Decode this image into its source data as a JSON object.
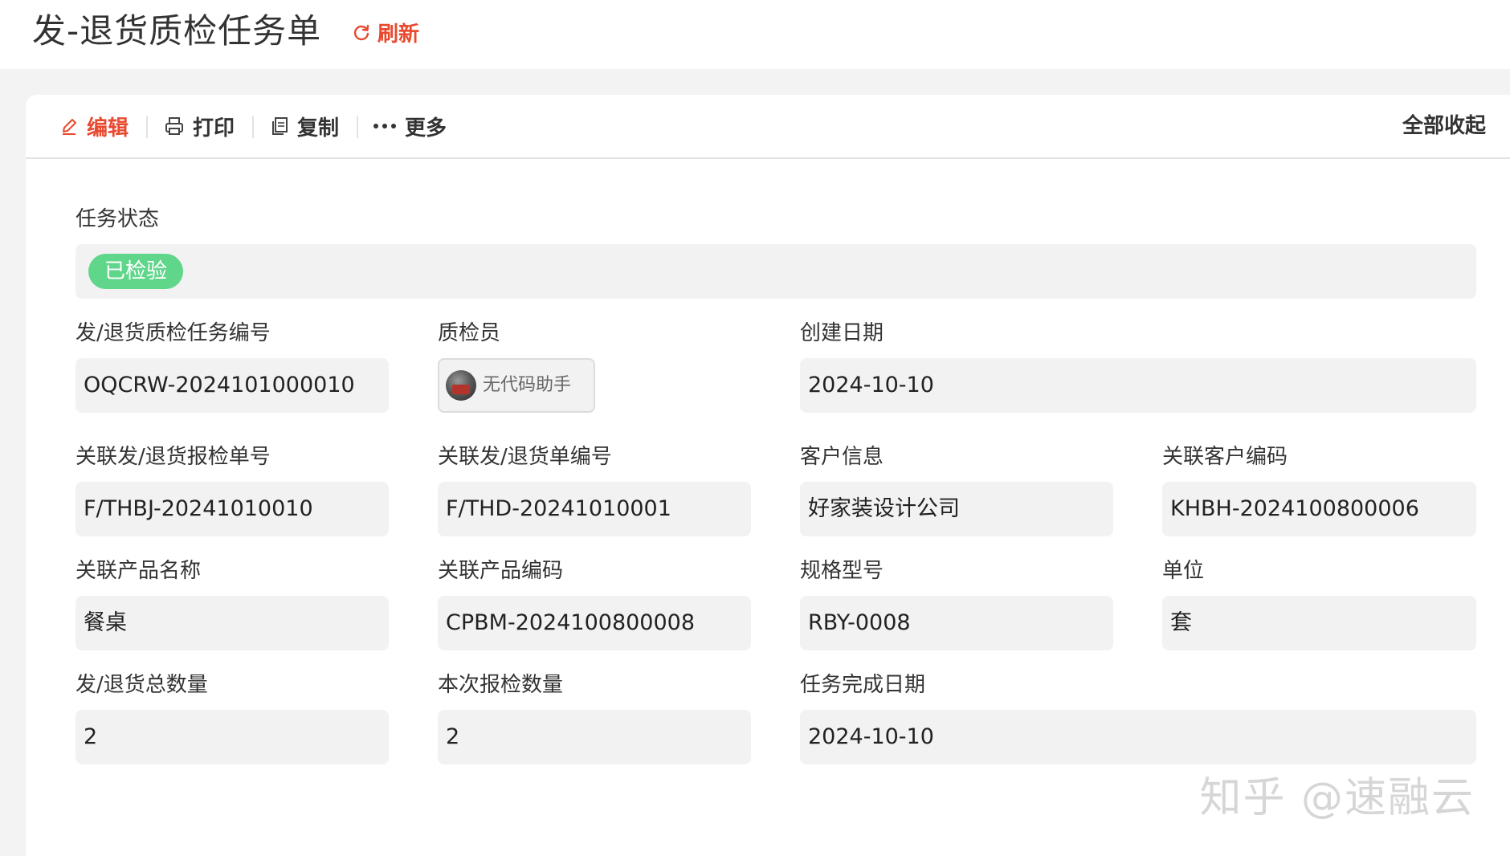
{
  "header": {
    "title": "发-退货质检任务单",
    "refresh_label": "刷新"
  },
  "toolbar": {
    "edit_label": "编辑",
    "print_label": "打印",
    "copy_label": "复制",
    "more_label": "更多",
    "collapse_label": "全部收起"
  },
  "status": {
    "label": "任务状态",
    "value": "已检验",
    "color": "#5fd68a"
  },
  "fields": {
    "task_no": {
      "label": "发/退货质检任务编号",
      "value": "OQCRW-2024101000010"
    },
    "inspector": {
      "label": "质检员",
      "value": "无代码助手"
    },
    "created_date": {
      "label": "创建日期",
      "value": "2024-10-10"
    },
    "report_no": {
      "label": "关联发/退货报检单号",
      "value": "F/THBJ-20241010010"
    },
    "order_no": {
      "label": "关联发/退货单编号",
      "value": "F/THD-20241010001"
    },
    "customer": {
      "label": "客户信息",
      "value": "好家装设计公司"
    },
    "customer_code": {
      "label": "关联客户编码",
      "value": "KHBH-2024100800006"
    },
    "product_name": {
      "label": "关联产品名称",
      "value": "餐桌"
    },
    "product_code": {
      "label": "关联产品编码",
      "value": "CPBM-2024100800008"
    },
    "spec": {
      "label": "规格型号",
      "value": "RBY-0008"
    },
    "unit": {
      "label": "单位",
      "value": "套"
    },
    "total_qty": {
      "label": "发/退货总数量",
      "value": "2"
    },
    "inspect_qty": {
      "label": "本次报检数量",
      "value": "2"
    },
    "finish_date": {
      "label": "任务完成日期",
      "value": "2024-10-10"
    }
  },
  "watermark": "知乎 @速融云",
  "colors": {
    "accent": "#e8492f",
    "field_bg": "#f2f2f2"
  }
}
